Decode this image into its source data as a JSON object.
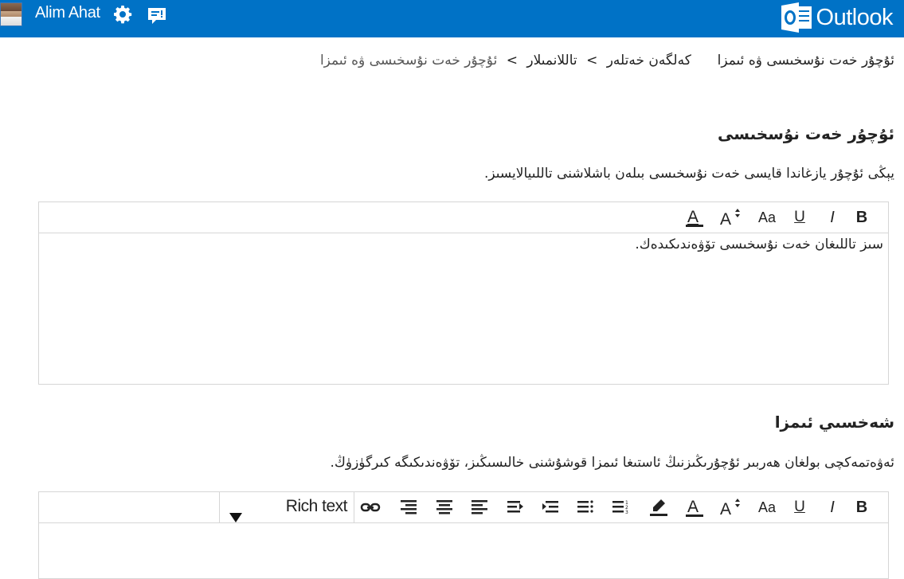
{
  "header": {
    "user_name": "Alim Ahat",
    "brand_name": "Outlook",
    "brand_color": "#0072c6",
    "icons": [
      "avatar",
      "gear-icon",
      "feedback-icon",
      "outlook-logo-icon"
    ]
  },
  "breadcrumb": {
    "page_title": "ئۇچۇر خەت نۇسخىسى ۋە ئىمزا",
    "items": [
      "كەلگەن خەتلەر",
      "تاللانمىلار",
      "ئۇچۇر خەت نۇسخىسى ۋە ئىمزا"
    ],
    "separator": ">"
  },
  "template_section": {
    "heading": "ئۇچۇر خەت نۇسخىسى",
    "description": "يېڭى ئۇچۇر يازغاندا قايسى خەت نۇسخىسى بىلەن باشلاشنى تاللىيالايسىز.",
    "editor_text": "سىز تاللىغان خەت نۇسخىسى تۆۋەندىكىدەك."
  },
  "signature_section": {
    "heading": "شەخسىي ئىمزا",
    "description": "ئەۋەتمەكچى بولغان ھەربىر ئۇچۇرىڭىزنىڭ ئاستىغا ئىمزا قوشۇشنى خالىسىڭىز، تۆۋەندىكىگە كىرگۈزۈڭ.",
    "format_select_value": "Rich text"
  },
  "toolbar_icons": {
    "bold": "B",
    "italic": "I",
    "underline": "U",
    "font_face": "Aa",
    "font_size": "A",
    "font_color": "A",
    "highlight": "highlight-icon",
    "numbered_list": "numbered-list-icon",
    "bullet_list": "bullet-list-icon",
    "decrease_indent": "decrease-indent-icon",
    "increase_indent": "increase-indent-icon",
    "align_left": "align-left-icon",
    "align_center": "align-center-icon",
    "align_right": "align-right-icon",
    "link": "link-icon"
  }
}
